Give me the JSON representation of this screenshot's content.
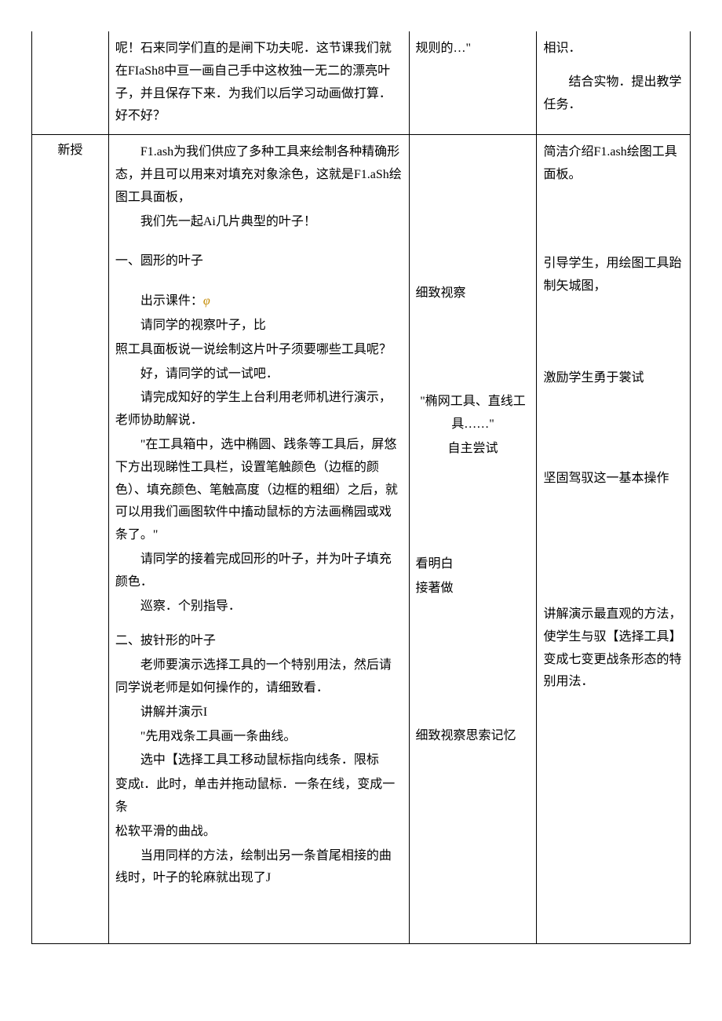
{
  "row1": {
    "col1": "",
    "col2": {
      "p1": "呢！石来同学们直的是闸下功夫呢．这节课我们就在FIaSh8中亘一画自己手中这枚独一无二的漂亮叶子，并且保存下来．为我们以后学习动画做打算．好不好？",
      "px": ""
    },
    "col3": {
      "p1": "规则的…\""
    },
    "col4": {
      "p1": "相识．",
      "p2": "结合实物．提出教学任务．"
    }
  },
  "row2": {
    "col1": "新授",
    "col2": {
      "p1": "F1.ash为我们供应了多种工具来绘制各种精确形态，并且可以用来对填充对象涂色，这就是F1.aSh绘图工具面板，",
      "p2": "我们先一起Ai几片典型的叶子！",
      "h1": "一、圆形的叶子",
      "p3a": "出示课件：",
      "p3b": "φ",
      "p4": "请同学的视察叶子，比",
      "p5": "照工具面板说一说绘制这片叶子须要哪些工具呢？",
      "p6": "好，请同学的试一试吧．",
      "p7": "请完成知好的学生上台利用老师机进行演示，老师协助解说．",
      "p8": "\"在工具箱中，选中椭圆、践条等工具后，屏悠下方出现睇性工具栏，设置笔触颜色（边框的颜色）、填充颜色、笔触高度（边框的粗细）之后，就可以用我们画图软件中搐动鼠标的方法画椭园或戏条了。\"",
      "p9": "请同学的接着完成回形的叶子，并为叶子填充颜色．",
      "p10": "巡察．个别指导．",
      "h2": "二、披针形的叶子",
      "p11": "老师要演示选择工具的一个特别用法，然后请同学说老师是如何操作的，请细致看．",
      "p12": "讲解并演示I",
      "p13": "\"先用戏条工具画一条曲线。",
      "p14": "选中【选择工具工移动鼠标指向线条．限标",
      "p15": "变成t．此时，单击并拖动鼠标．一条在线，变成一条",
      "p16": "松软平滑的曲战。",
      "p17": "当用同样的方法，绘制出另一条首尾相接的曲线时，叶子的轮麻就出现了J"
    },
    "col3": {
      "p1": "细致视察",
      "p2": "\"椭网工具、直线工具……\"",
      "p3": "自主尝试",
      "p4": "看明白",
      "p5": "接著做",
      "p6": "细致视察思索记忆"
    },
    "col4": {
      "p1": "简洁介绍F1.ash绘图工具面板。",
      "p2": "引导学生，用绘图工具跆制矢城图，",
      "p3": "激励学生勇于裳试",
      "p4": "坚固驾驭这一基本操作",
      "p5": "讲解演示最直观的方法，使学生与驭【选择工具】变成七变更战条形态的特别用法．"
    }
  }
}
